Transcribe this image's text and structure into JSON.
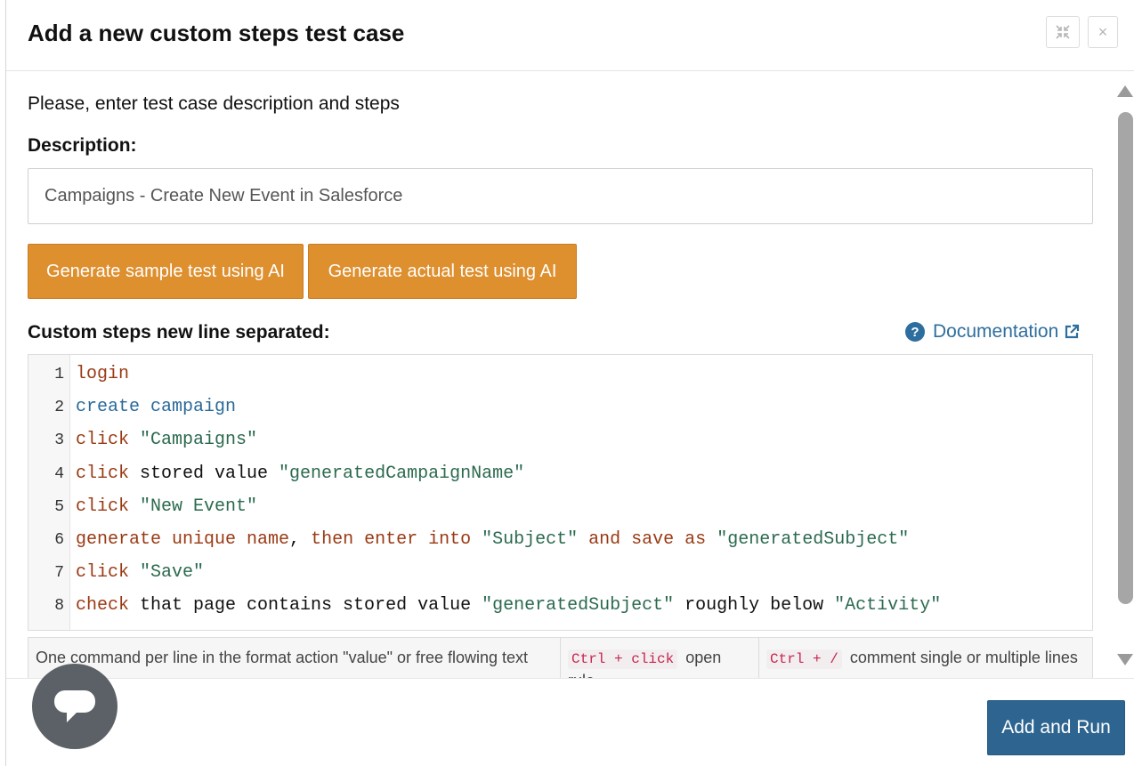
{
  "dialog": {
    "title": "Add a new custom steps test case",
    "minimize_icon": "collapse-arrows-icon",
    "close_label": "×"
  },
  "form": {
    "intro": "Please, enter test case description and steps",
    "description_label": "Description:",
    "description_value": "Campaigns - Create New Event in Salesforce",
    "generate_sample_label": "Generate sample test using AI",
    "generate_actual_label": "Generate actual test using AI",
    "steps_label": "Custom steps new line separated:",
    "documentation_label": "Documentation"
  },
  "editor": {
    "lines": [
      {
        "n": "1",
        "tokens": [
          {
            "t": "login",
            "c": "kw"
          }
        ]
      },
      {
        "n": "2",
        "tokens": [
          {
            "t": "create campaign",
            "c": "fn"
          }
        ]
      },
      {
        "n": "3",
        "tokens": [
          {
            "t": "click",
            "c": "kw"
          },
          {
            "t": " ",
            "c": "pl"
          },
          {
            "t": "\"Campaigns\"",
            "c": "str"
          }
        ]
      },
      {
        "n": "4",
        "tokens": [
          {
            "t": "click",
            "c": "kw"
          },
          {
            "t": " stored value ",
            "c": "pl"
          },
          {
            "t": "\"generatedCampaignName\"",
            "c": "str"
          }
        ]
      },
      {
        "n": "5",
        "tokens": [
          {
            "t": "click",
            "c": "kw"
          },
          {
            "t": " ",
            "c": "pl"
          },
          {
            "t": "\"New Event\"",
            "c": "str"
          }
        ]
      },
      {
        "n": "6",
        "tokens": [
          {
            "t": "generate unique name",
            "c": "kw"
          },
          {
            "t": ", ",
            "c": "pl"
          },
          {
            "t": "then enter into",
            "c": "kw"
          },
          {
            "t": " ",
            "c": "pl"
          },
          {
            "t": "\"Subject\"",
            "c": "str"
          },
          {
            "t": " ",
            "c": "pl"
          },
          {
            "t": "and save as",
            "c": "kw"
          },
          {
            "t": " ",
            "c": "pl"
          },
          {
            "t": "\"generatedSubject\"",
            "c": "str"
          }
        ]
      },
      {
        "n": "7",
        "tokens": [
          {
            "t": "click",
            "c": "kw"
          },
          {
            "t": " ",
            "c": "pl"
          },
          {
            "t": "\"Save\"",
            "c": "str"
          }
        ]
      },
      {
        "n": "8",
        "tokens": [
          {
            "t": "check",
            "c": "kw"
          },
          {
            "t": " that page contains stored value ",
            "c": "pl"
          },
          {
            "t": "\"generatedSubject\"",
            "c": "str"
          },
          {
            "t": " roughly below ",
            "c": "pl"
          },
          {
            "t": "\"Activity\"",
            "c": "str"
          }
        ]
      }
    ]
  },
  "hints": {
    "format_text": "One command per line in the format action \"value\" or free flowing text",
    "open_kbd": "Ctrl + click",
    "open_text": "open rule",
    "comment_kbd": "Ctrl + /",
    "comment_text": "comment single or multiple lines"
  },
  "footer": {
    "add_and_run_label": "Add and Run",
    "chat_icon": "chat-bubble-icon"
  },
  "colors": {
    "ai_button": "#de8f2e",
    "primary_button": "#2e6590",
    "link": "#2e6e9e",
    "keyword": "#9a3a14",
    "function": "#2a6a9a",
    "string": "#2b6a4e"
  }
}
